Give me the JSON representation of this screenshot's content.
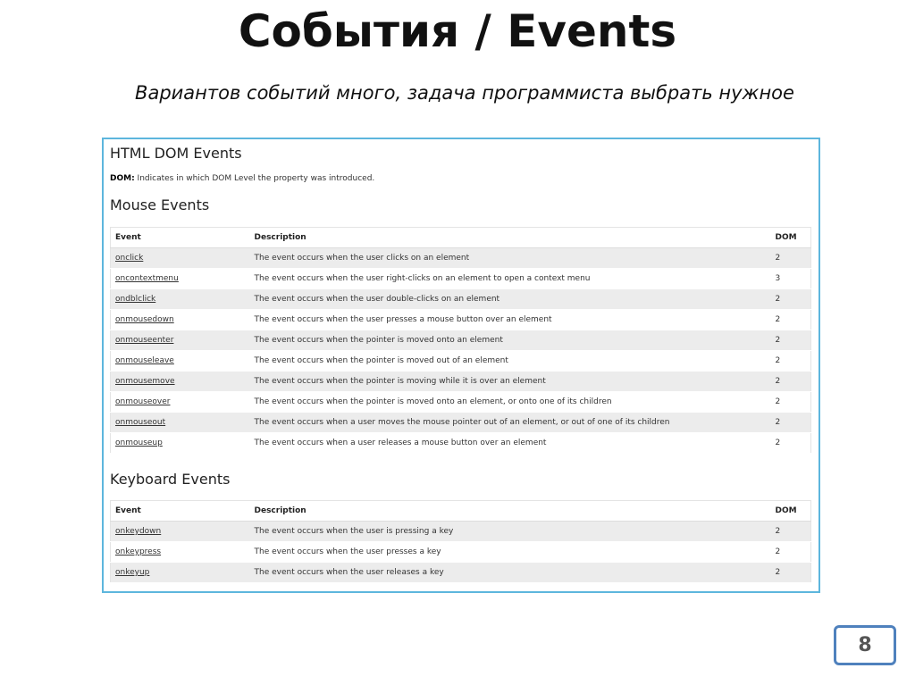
{
  "slide": {
    "title": "События / Events",
    "subtitle": "Вариантов событий много, задача программиста выбрать нужное",
    "page_number": "8"
  },
  "panel": {
    "title": "HTML DOM Events",
    "dom_note_label": "DOM:",
    "dom_note_text": " Indicates in which DOM Level the property was introduced."
  },
  "mouse": {
    "title": "Mouse Events",
    "headers": [
      "Event",
      "Description",
      "DOM"
    ],
    "rows": [
      {
        "event": "onclick",
        "description": "The event occurs when the user clicks on an element",
        "dom": "2"
      },
      {
        "event": "oncontextmenu",
        "description": "The event occurs when the user right-clicks on an element to open a context menu",
        "dom": "3"
      },
      {
        "event": "ondblclick",
        "description": "The event occurs when the user double-clicks on an element",
        "dom": "2"
      },
      {
        "event": "onmousedown",
        "description": "The event occurs when the user presses a mouse button over an element",
        "dom": "2"
      },
      {
        "event": "onmouseenter",
        "description": "The event occurs when the pointer is moved onto an element",
        "dom": "2"
      },
      {
        "event": "onmouseleave",
        "description": "The event occurs when the pointer is moved out of an element",
        "dom": "2"
      },
      {
        "event": "onmousemove",
        "description": "The event occurs when the pointer is moving while it is over an element",
        "dom": "2"
      },
      {
        "event": "onmouseover",
        "description": "The event occurs when the pointer is moved onto an element, or onto one of its children",
        "dom": "2"
      },
      {
        "event": "onmouseout",
        "description": "The event occurs when a user moves the mouse pointer out of an element, or out of one of its children",
        "dom": "2"
      },
      {
        "event": "onmouseup",
        "description": "The event occurs when a user releases a mouse button over an element",
        "dom": "2"
      }
    ]
  },
  "keyboard": {
    "title": "Keyboard Events",
    "headers": [
      "Event",
      "Description",
      "DOM"
    ],
    "rows": [
      {
        "event": "onkeydown",
        "description": "The event occurs when the user is pressing a key",
        "dom": "2"
      },
      {
        "event": "onkeypress",
        "description": "The event occurs when the user presses a key",
        "dom": "2"
      },
      {
        "event": "onkeyup",
        "description": "The event occurs when the user releases a key",
        "dom": "2"
      }
    ]
  },
  "colors": {
    "panel_border": "#5db6dd",
    "row_stripe": "#ececec",
    "page_box_border": "#4f81bd"
  }
}
